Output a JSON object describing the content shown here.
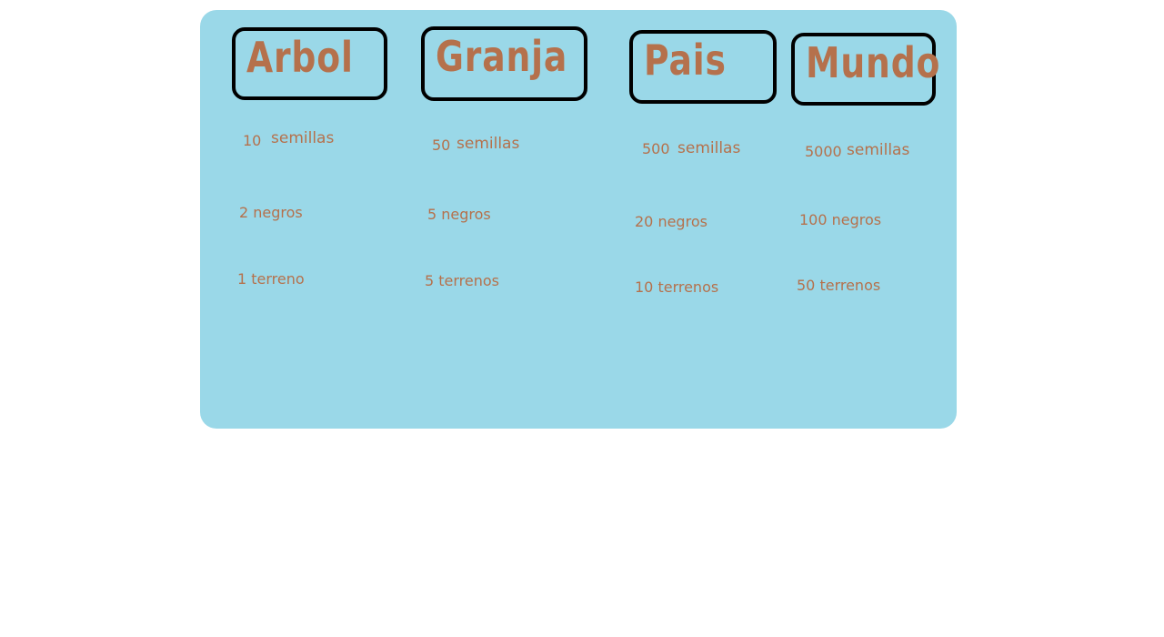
{
  "upgrades": [
    {
      "title": "Arbol",
      "seeds_amount": "10",
      "seeds_label": "semillas",
      "workers": "2 negros",
      "land": "1 terreno"
    },
    {
      "title": "Granja",
      "seeds_amount": "50",
      "seeds_label": "semillas",
      "workers": "5 negros",
      "land": "5 terrenos"
    },
    {
      "title": "Pais",
      "seeds_amount": "500",
      "seeds_label": "semillas",
      "workers": "20 negros",
      "land": "10 terrenos"
    },
    {
      "title": "Mundo",
      "seeds_amount": "5000",
      "seeds_label": "semillas",
      "workers": "100 negros",
      "land": "50 terrenos"
    }
  ],
  "colors": {
    "panel_background": "#9ad8e8",
    "text": "#b5714c",
    "button_border": "#000000"
  }
}
